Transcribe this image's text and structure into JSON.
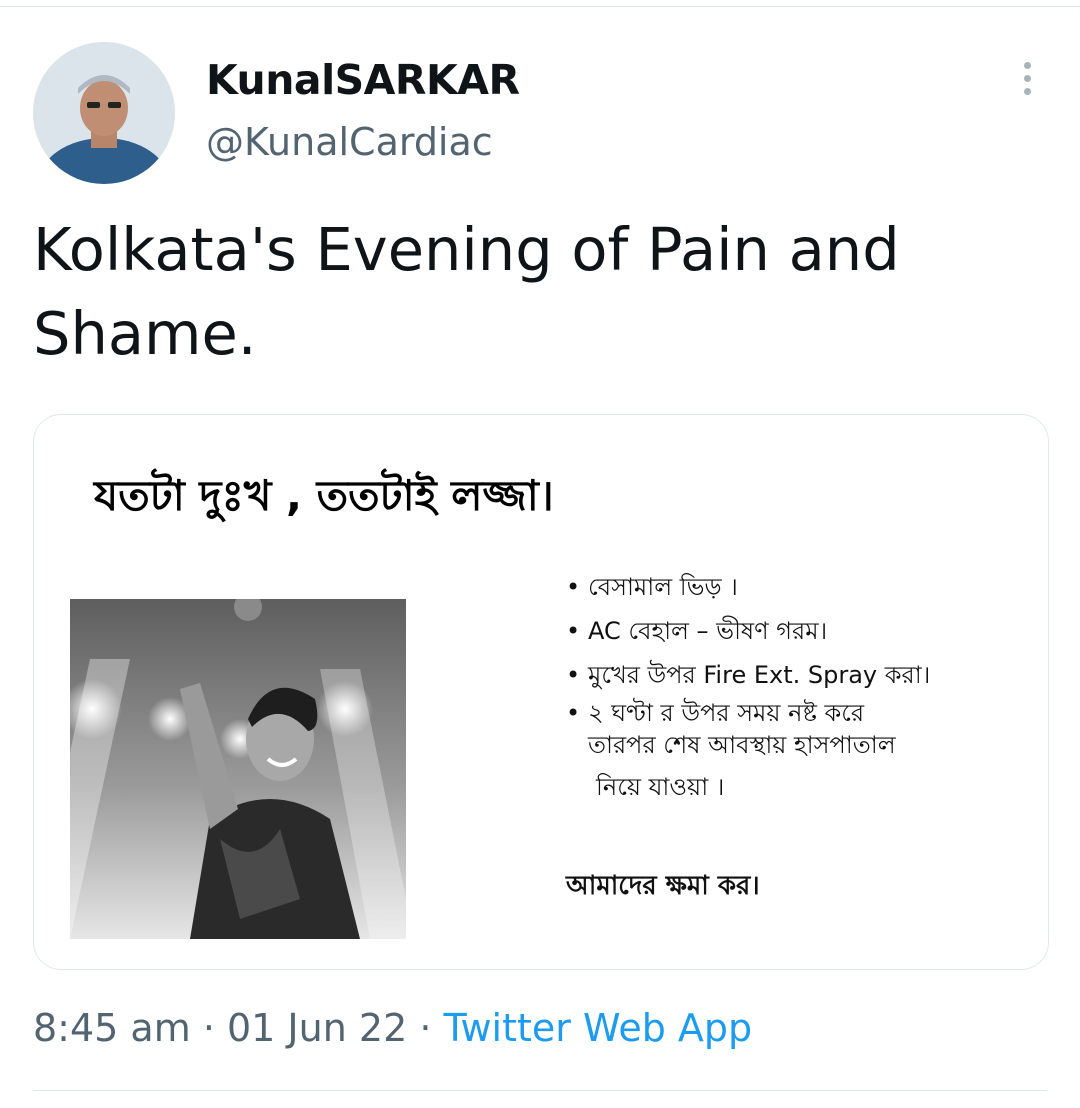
{
  "author": {
    "name": "KunalSARKAR",
    "handle": "@KunalCardiac"
  },
  "tweet": {
    "text": "Kolkata's Evening of Pain and Shame."
  },
  "card": {
    "title": "যতটা দুঃখ , ততটাই লজ্জা।",
    "bullets": [
      "বেসামাল ভিড় ।",
      "AC বেহাল – ভীষণ গরম।",
      "মুখের উপর Fire Ext. Spray করা।",
      "২ ঘণ্টা র উপর সময় নষ্ট করে"
    ],
    "bullet_continuation_1": "তারপর শেষ আবস্থায় হাসপাতাল",
    "bullet_continuation_2": "নিয়ে যাওয়া ।",
    "closing": "আমাদের ক্ষমা কর।"
  },
  "meta": {
    "time": "8:45 am",
    "separator": "·",
    "date": "01 Jun 22",
    "source": "Twitter Web App"
  },
  "colors": {
    "link": "#1d9bf0",
    "secondary_text": "#536471"
  },
  "icons": {
    "more": "more-vertical-icon"
  }
}
